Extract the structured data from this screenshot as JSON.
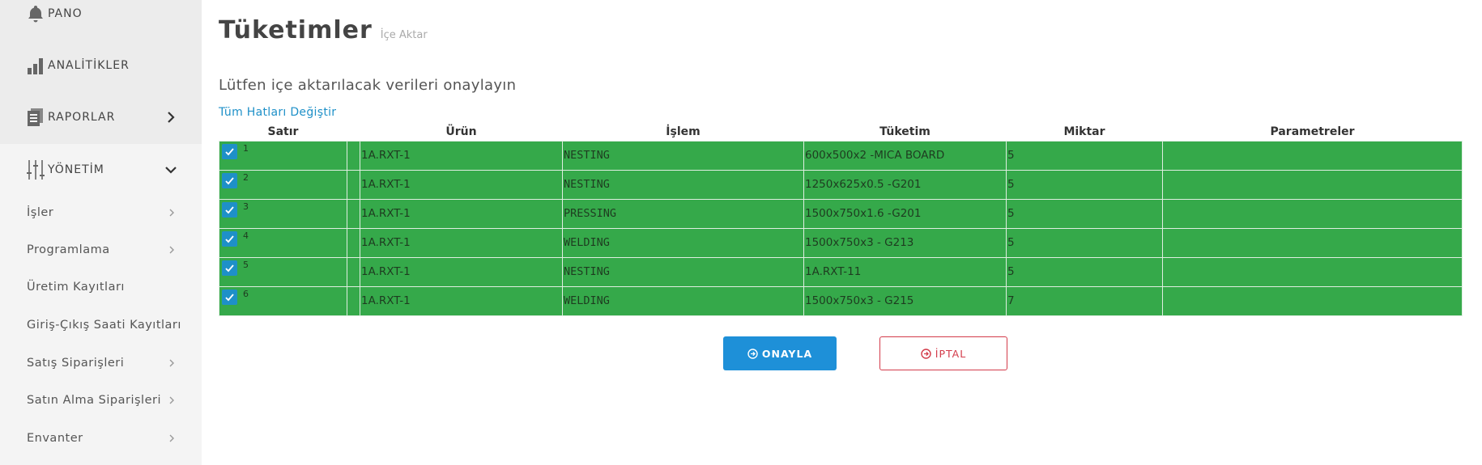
{
  "sidebar": {
    "main_items": [
      {
        "label": "PANO",
        "icon": "bell-icon"
      },
      {
        "label": "ANALİTİKLER",
        "icon": "bar-chart-icon"
      },
      {
        "label": "RAPORLAR",
        "icon": "report-icon"
      },
      {
        "label": "YÖNETİM",
        "icon": "sliders-icon"
      }
    ],
    "sub_items": [
      {
        "label": "İşler",
        "has_chevron": true
      },
      {
        "label": "Programlama",
        "has_chevron": true
      },
      {
        "label": "Üretim Kayıtları",
        "has_chevron": false
      },
      {
        "label": "Giriş-Çıkış Saati Kayıtları",
        "has_chevron": false
      },
      {
        "label": "Satış Siparişleri",
        "has_chevron": true
      },
      {
        "label": "Satın Alma Siparişleri",
        "has_chevron": true
      },
      {
        "label": "Envanter",
        "has_chevron": true
      }
    ]
  },
  "header": {
    "title": "Tüketimler",
    "subtitle": "İçe Aktar"
  },
  "instruction": "Lütfen içe aktarılacak verileri onaylayın",
  "toggle_all_link": "Tüm Hatları Değiştir",
  "table": {
    "columns": [
      "Satır",
      "",
      "Ürün",
      "İşlem",
      "Tüketim",
      "Miktar",
      "Parametreler"
    ],
    "rows": [
      {
        "row": "1",
        "checked": true,
        "product": "1A.RXT-1",
        "operation": "NESTING",
        "consumption": "600x500x2 -MICA BOARD",
        "quantity": "5",
        "parameters": ""
      },
      {
        "row": "2",
        "checked": true,
        "product": "1A.RXT-1",
        "operation": "NESTING",
        "consumption": "1250x625x0.5 -G201",
        "quantity": "5",
        "parameters": ""
      },
      {
        "row": "3",
        "checked": true,
        "product": "1A.RXT-1",
        "operation": "PRESSING",
        "consumption": "1500x750x1.6 -G201",
        "quantity": "5",
        "parameters": ""
      },
      {
        "row": "4",
        "checked": true,
        "product": "1A.RXT-1",
        "operation": "WELDING",
        "consumption": "1500x750x3 - G213",
        "quantity": "5",
        "parameters": ""
      },
      {
        "row": "5",
        "checked": true,
        "product": "1A.RXT-1",
        "operation": "NESTING",
        "consumption": "1A.RXT-11",
        "quantity": "5",
        "parameters": ""
      },
      {
        "row": "6",
        "checked": true,
        "product": "1A.RXT-1",
        "operation": "WELDING",
        "consumption": "1500x750x3 - G215",
        "quantity": "7",
        "parameters": ""
      }
    ]
  },
  "buttons": {
    "confirm": "ONAYLA",
    "cancel": "İPTAL"
  },
  "colors": {
    "row_green": "#35a94a",
    "accent_blue": "#1e90d8",
    "cancel_red": "#d33b4a"
  }
}
